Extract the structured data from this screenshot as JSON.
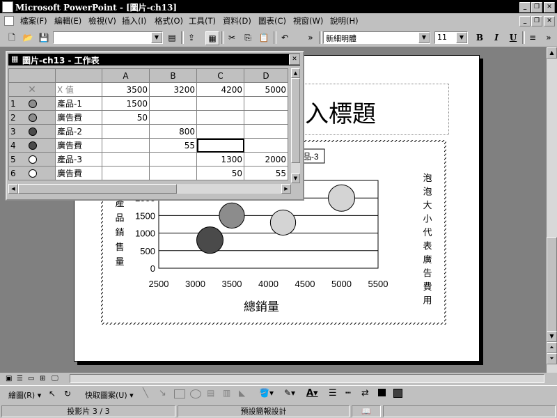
{
  "app": {
    "title": "Microsoft PowerPoint - [圖片-ch13]",
    "window_buttons": [
      "_",
      "🗗",
      "✕"
    ],
    "doc_buttons": [
      "_",
      "🗗",
      "✕"
    ]
  },
  "menu": {
    "items": [
      "檔案(F)",
      "編輯(E)",
      "檢視(V)",
      "插入(I)",
      "格式(O)",
      "工具(T)",
      "資料(D)",
      "圖表(C)",
      "視窗(W)",
      "說明(H)"
    ]
  },
  "toolbar": {
    "font_name": "新細明體",
    "font_size": "11",
    "bold": "B",
    "italic": "I",
    "underline": "U"
  },
  "slide": {
    "title_placeholder": "入標題",
    "legend_partial": "品-3"
  },
  "datasheet": {
    "title": "圖片-ch13 - 工作表",
    "columns": [
      "",
      "",
      "A",
      "B",
      "C",
      "D"
    ],
    "xrow": {
      "label": "X 值",
      "values": [
        "3500",
        "3200",
        "4200",
        "5000"
      ]
    },
    "rows": [
      {
        "num": "1",
        "label": "產品-1",
        "values": [
          "1500",
          "",
          "",
          ""
        ]
      },
      {
        "num": "2",
        "label": "廣告費",
        "values": [
          "50",
          "",
          "",
          ""
        ]
      },
      {
        "num": "3",
        "label": "產品-2",
        "values": [
          "",
          "800",
          "",
          ""
        ]
      },
      {
        "num": "4",
        "label": "廣告費",
        "values": [
          "",
          "55",
          "",
          ""
        ]
      },
      {
        "num": "5",
        "label": "產品-3",
        "values": [
          "",
          "",
          "1300",
          "2000"
        ]
      },
      {
        "num": "6",
        "label": "廣告費",
        "values": [
          "",
          "",
          "50",
          "55"
        ]
      }
    ]
  },
  "chart_data": {
    "type": "scatter",
    "xlabel": "總銷量",
    "ylabel": "產品銷售量",
    "right_label": "泡泡大小代表廣告費用",
    "xlim": [
      2500,
      5500
    ],
    "ylim": [
      0,
      2500
    ],
    "xticks": [
      "2500",
      "3000",
      "3500",
      "4000",
      "4500",
      "5000",
      "5500"
    ],
    "yticks": [
      "0",
      "500",
      "1000",
      "1500",
      "2000"
    ],
    "series": [
      {
        "name": "產品-1",
        "x": [
          3500
        ],
        "y": [
          1500
        ],
        "size": [
          50
        ],
        "color": "#8c8c8c"
      },
      {
        "name": "產品-2",
        "x": [
          3200
        ],
        "y": [
          800
        ],
        "size": [
          55
        ],
        "color": "#4a4a4a"
      },
      {
        "name": "產品-3",
        "x": [
          4200,
          5000
        ],
        "y": [
          1300,
          2000
        ],
        "size": [
          50,
          55
        ],
        "color": "#d4d4d4"
      }
    ]
  },
  "view_bar": {
    "draw_label": "繪圖(R)",
    "autoshapes_label": "快取圖案(U)"
  },
  "status": {
    "slide": "投影片 3 / 3",
    "design": "預設簡報設計"
  }
}
